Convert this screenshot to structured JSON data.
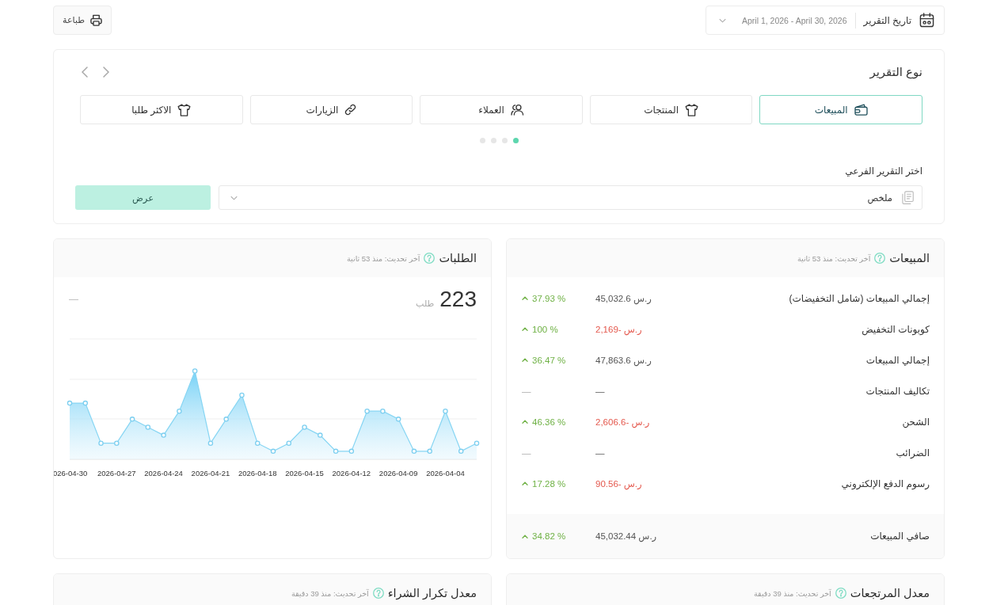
{
  "toolbar": {
    "date_range": {
      "label": "تاريخ التقرير",
      "value": "April 1, 2026 - April 30, 2026"
    },
    "print_button": "طباعة"
  },
  "report_type": {
    "title": "نوع التقرير",
    "tabs": [
      {
        "label": "المبيعات",
        "kind": "sales",
        "selected": true
      },
      {
        "label": "المنتجات",
        "kind": "products",
        "selected": false
      },
      {
        "label": "العملاء",
        "kind": "customers",
        "selected": false
      },
      {
        "label": "الزيارات",
        "kind": "visits",
        "selected": false
      },
      {
        "label": "الاكثر طلبا",
        "kind": "bestsellers",
        "selected": false
      }
    ],
    "pager": [
      {
        "selected": true
      },
      {
        "selected": false
      },
      {
        "selected": false
      },
      {
        "selected": false
      }
    ],
    "sub_report": {
      "label": "اختر التقرير الفرعي",
      "value": "ملخص",
      "button": "عرض"
    }
  },
  "sales_card": {
    "title": "المبيعات",
    "updated": "آخر تحديث: منذ 53 ثانية",
    "rows": [
      {
        "label": "إجمالي المبيعات (شامل التخفيضات)",
        "value": "ر.س 45,032.6",
        "negative": false,
        "change": "37.93 %",
        "rising": true
      },
      {
        "label": "كوبونات التخفيض",
        "value": "ر.س -2,169",
        "negative": true,
        "change": "100 %",
        "rising": true
      },
      {
        "label": "إجمالي المبيعات",
        "value": "ر.س 47,863.6",
        "negative": false,
        "change": "36.47 %",
        "rising": true
      },
      {
        "label": "تكاليف المنتجات",
        "value": "—",
        "negative": false,
        "change": "—",
        "rising": false
      },
      {
        "label": "الشحن",
        "value": "ر.س -2,606.6",
        "negative": true,
        "change": "46.36 %",
        "rising": true
      },
      {
        "label": "الضرائب",
        "value": "—",
        "negative": false,
        "change": "—",
        "rising": false
      },
      {
        "label": "رسوم الدفع الإلكتروني",
        "value": "ر.س -90.56",
        "negative": true,
        "change": "17.28 %",
        "rising": true
      }
    ],
    "total": {
      "label": "صافي المبيعات",
      "value": "ر.س 45,032.44",
      "negative": false,
      "change": "34.82 %",
      "rising": true
    }
  },
  "orders_card": {
    "title": "الطلبات",
    "updated": "آخر تحديث: منذ 53 ثانية",
    "count": "223",
    "unit": "طلب",
    "comparison": "—",
    "x_labels": [
      "2026-04-04",
      "2026-04-09",
      "2026-04-12",
      "2026-04-15",
      "2026-04-18",
      "2026-04-21",
      "2026-04-24",
      "2026-04-27",
      "026-04-30"
    ]
  },
  "bottom_cards": [
    {
      "title": "معدل المرتجعات",
      "updated": "آخر تحديث: منذ 39 دقيقة"
    },
    {
      "title": "معدل تكرار الشراء",
      "updated": "آخر تحديث: منذ 39 دقيقة"
    }
  ]
}
